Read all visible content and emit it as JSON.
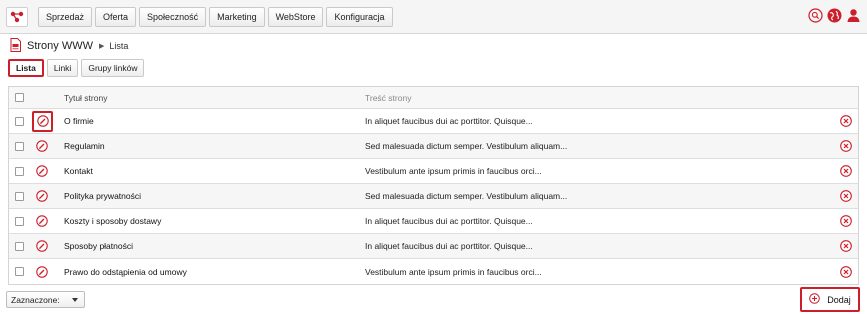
{
  "nav": [
    "Sprzedaż",
    "Oferta",
    "Społeczność",
    "Marketing",
    "WebStore",
    "Konfiguracja"
  ],
  "breadcrumb": {
    "title": "Strony WWW",
    "current": "Lista"
  },
  "tabs": [
    "Lista",
    "Linki",
    "Grupy linków"
  ],
  "table": {
    "headers": {
      "title": "Tytuł strony",
      "content": "Treść strony"
    },
    "rows": [
      {
        "title": "O firmie",
        "content": "In aliquet faucibus dui ac porttitor. Quisque..."
      },
      {
        "title": "Regulamin",
        "content": "Sed malesuada dictum semper. Vestibulum aliquam..."
      },
      {
        "title": "Kontakt",
        "content": "Vestibulum ante ipsum primis in faucibus orci..."
      },
      {
        "title": "Polityka prywatności",
        "content": "Sed malesuada dictum semper. Vestibulum aliquam..."
      },
      {
        "title": "Koszty i sposoby dostawy",
        "content": "In aliquet faucibus dui ac porttitor. Quisque..."
      },
      {
        "title": "Sposoby płatności",
        "content": "In aliquet faucibus dui ac porttitor. Quisque..."
      },
      {
        "title": "Prawo do odstąpienia od umowy",
        "content": "Vestibulum ante ipsum primis in faucibus orci..."
      }
    ]
  },
  "footer": {
    "selected_label": "Zaznaczone:",
    "add_label": "Dodaj"
  },
  "colors": {
    "accent": "#cc1e2b",
    "highlight_border": "#cc1e2b"
  },
  "icons": {
    "logo": "brand-logo-icon",
    "top": [
      "search-icon",
      "globe-icon",
      "user-icon"
    ],
    "page": "document-icon",
    "edit": "edit-circle-icon",
    "delete": "delete-circle-icon",
    "add": "add-circle-icon"
  }
}
